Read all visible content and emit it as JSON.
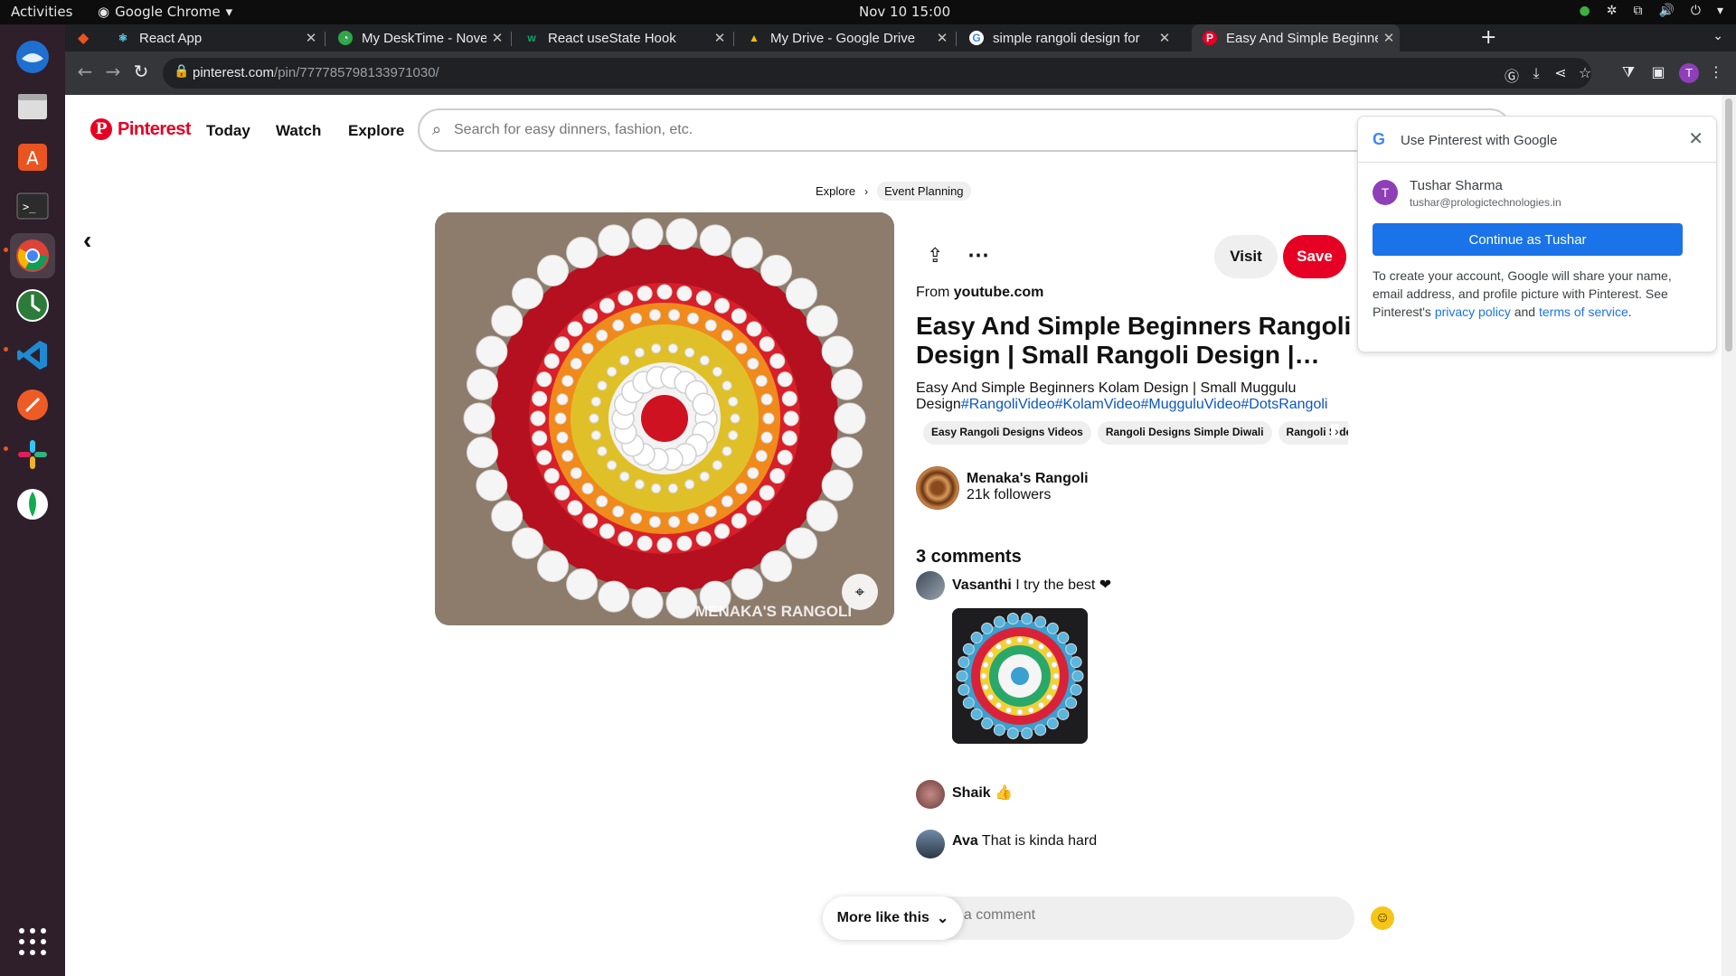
{
  "os": {
    "activities": "Activities",
    "app_menu": "Google Chrome",
    "clock": "Nov 10  15:00"
  },
  "tabs": [
    {
      "title": "React App",
      "favicon_color": "#61dafb",
      "favicon": "⚛"
    },
    {
      "title": "My DeskTime - November",
      "favicon_color": "#31a54a",
      "favicon": "◔"
    },
    {
      "title": "React useState Hook",
      "favicon_color": "#04aa6d",
      "favicon": "w"
    },
    {
      "title": "My Drive - Google Drive",
      "favicon_color": "#fbbc04",
      "favicon": "▲"
    },
    {
      "title": "simple rangoli design for",
      "favicon_color": "#ffffff",
      "favicon": "G"
    },
    {
      "title": "Easy And Simple Beginne",
      "favicon_color": "#e60023",
      "favicon": "P"
    }
  ],
  "toolbar": {
    "url_host": "pinterest.com",
    "url_path": "/pin/777785798133971030/",
    "profile_initial": "T"
  },
  "header": {
    "logo_text": "Pinterest",
    "nav": [
      "Today",
      "Watch",
      "Explore"
    ],
    "search_placeholder": "Search for easy dinners, fashion, etc."
  },
  "breadcrumb": [
    "Explore",
    "Event Planning"
  ],
  "pin": {
    "watermark": "MENAKA'S RANGOLI",
    "visit_label": "Visit",
    "save_label": "Save",
    "from_prefix": "From",
    "from_domain": "youtube.com",
    "title": "Easy And Simple Beginners Rangoli Design | Small Rangoli Design | Kolam",
    "description": "Easy And Simple Beginners Kolam Design | Small Muggulu Design",
    "hashtags": "#RangoliVideo#KolamVideo#MugguluVideo#DotsRangoli",
    "chips": [
      "Easy Rangoli Designs Videos",
      "Rangoli Designs Simple Diwali",
      "Rangoli Side Designs"
    ],
    "creator_name": "Menaka's Rangoli",
    "creator_followers": "21k followers"
  },
  "comments": {
    "heading": "3 comments",
    "items": [
      {
        "author": "Vasanthi",
        "text": "I try  the best ❤"
      },
      {
        "author": "Shaik",
        "text": "👍"
      },
      {
        "author": "Ava",
        "text": "That is kinda hard"
      }
    ],
    "more_like_label": "More like this",
    "input_placeholder": "Add a comment"
  },
  "google_popup": {
    "title": "Use Pinterest with Google",
    "user_name": "Tushar Sharma",
    "user_email": "tushar@prologictechnologies.in",
    "user_initial": "T",
    "cta_label": "Continue as Tushar",
    "info_1": "To create your account, Google will share your name, email address, and profile picture with Pinterest. See Pinterest's ",
    "privacy_link": "privacy policy",
    "info_and": " and ",
    "terms_link": "terms of service",
    "info_end": "."
  },
  "colors": {
    "pinterest_red": "#e60023",
    "google_blue": "#1a73e8",
    "hashtag_blue": "#0a56c2"
  }
}
